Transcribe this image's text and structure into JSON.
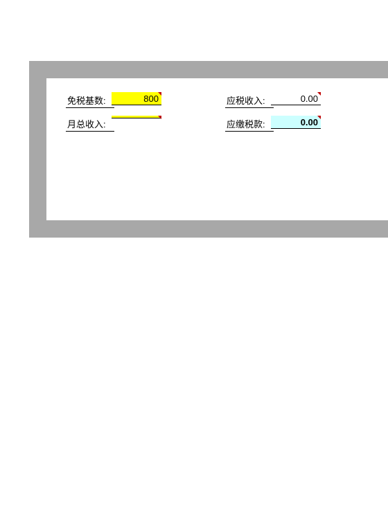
{
  "form": {
    "row1_left_label": "免税基数:",
    "row1_left_value": "800",
    "row1_right_label": "应税收入:",
    "row1_right_value": "0.00",
    "row2_left_label": "月总收入:",
    "row2_left_value": "",
    "row2_right_label": "应缴税款:",
    "row2_right_value": "0.00"
  }
}
